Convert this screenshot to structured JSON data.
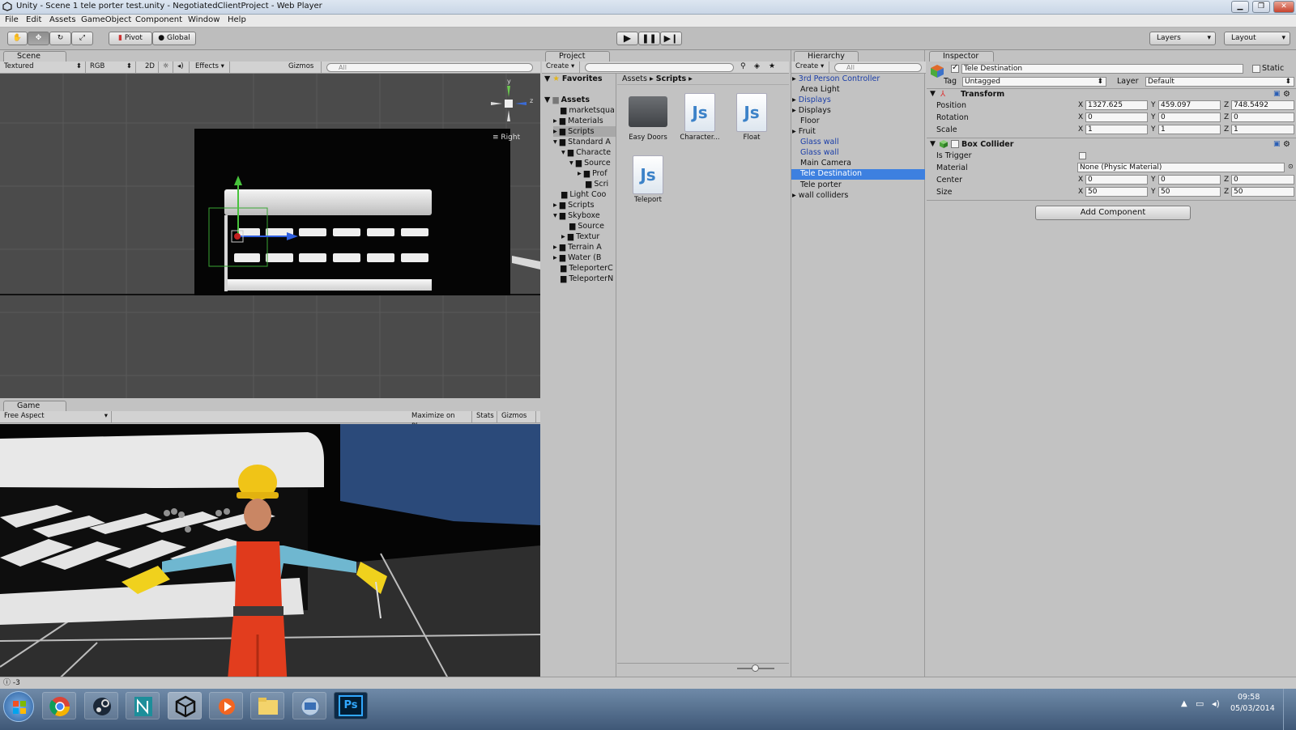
{
  "window": {
    "title": "Unity - Scene 1 tele porter test.unity - NegotiatedClientProject - Web Player",
    "min": "▁",
    "max": "❐",
    "close": "✕"
  },
  "menu": [
    "File",
    "Edit",
    "Assets",
    "GameObject",
    "Component",
    "Window",
    "Help"
  ],
  "toolbar": {
    "pivot": "Pivot",
    "global": "Global",
    "layers": "Layers",
    "layout": "Layout"
  },
  "scene": {
    "tab": "Scene",
    "shading": "Textured",
    "rendermode": "RGB",
    "twod": "2D",
    "effects": "Effects",
    "gizmos": "Gizmos",
    "search_placeholder": "All",
    "view_label": "Right",
    "gizmo_y": "y",
    "gizmo_z": "z"
  },
  "game": {
    "tab": "Game",
    "aspect": "Free Aspect",
    "maximize": "Maximize on Play",
    "stats": "Stats",
    "gizmos": "Gizmos"
  },
  "project": {
    "tab": "Project",
    "create": "Create",
    "favorites": "Favorites",
    "assets": "Assets",
    "breadcrumb": [
      "Assets",
      "Scripts"
    ],
    "tree": [
      "marketsqua",
      "Materials",
      "Scripts",
      "Standard A",
      "Characte",
      "Source",
      "Prof",
      "Scri",
      "Light Coo",
      "Scripts",
      "Skyboxe",
      "Source",
      "Textur",
      "Terrain A",
      "Water (B",
      "TeleporterC",
      "TeleporterN"
    ],
    "files": [
      {
        "name": "Easy Doors",
        "kind": "folder"
      },
      {
        "name": "Character...",
        "kind": "js"
      },
      {
        "name": "Float",
        "kind": "js"
      },
      {
        "name": "Teleport",
        "kind": "js"
      }
    ],
    "js_glyph": "Js"
  },
  "hierarchy": {
    "tab": "Hierarchy",
    "create": "Create",
    "search_placeholder": "All",
    "items": [
      {
        "label": "3rd Person Controller",
        "prefab": true,
        "arrow": true
      },
      {
        "label": "Area Light",
        "prefab": false,
        "arrow": false
      },
      {
        "label": "Displays",
        "prefab": true,
        "arrow": true
      },
      {
        "label": "Displays",
        "prefab": false,
        "arrow": true
      },
      {
        "label": "Floor",
        "prefab": false,
        "arrow": false
      },
      {
        "label": "Fruit",
        "prefab": false,
        "arrow": true
      },
      {
        "label": "Glass wall",
        "prefab": true,
        "arrow": false
      },
      {
        "label": "Glass wall",
        "prefab": true,
        "arrow": false
      },
      {
        "label": "Main Camera",
        "prefab": false,
        "arrow": false
      },
      {
        "label": "Tele Destination",
        "prefab": false,
        "arrow": false,
        "selected": true
      },
      {
        "label": "Tele porter",
        "prefab": false,
        "arrow": false
      },
      {
        "label": "wall colliders",
        "prefab": false,
        "arrow": true
      }
    ]
  },
  "inspector": {
    "tab": "Inspector",
    "object_name": "Tele Destination",
    "static": "Static",
    "tag_label": "Tag",
    "tag": "Untagged",
    "layer_label": "Layer",
    "layer": "Default",
    "transform": {
      "title": "Transform",
      "position": {
        "label": "Position",
        "x": "1327.625",
        "y": "459.097",
        "z": "748.5492"
      },
      "rotation": {
        "label": "Rotation",
        "x": "0",
        "y": "0",
        "z": "0"
      },
      "scale": {
        "label": "Scale",
        "x": "1",
        "y": "1",
        "z": "1"
      }
    },
    "box_collider": {
      "title": "Box Collider",
      "is_trigger": "Is Trigger",
      "material_label": "Material",
      "material": "None (Physic Material)",
      "center": {
        "label": "Center",
        "x": "0",
        "y": "0",
        "z": "0"
      },
      "size": {
        "label": "Size",
        "x": "50",
        "y": "50",
        "z": "50"
      }
    },
    "axis": {
      "x": "X",
      "y": "Y",
      "z": "Z"
    },
    "add_component": "Add Component"
  },
  "status": {
    "text": "-3"
  },
  "taskbar": {
    "time": "09:58",
    "date": "05/03/2014",
    "ps": "Ps"
  }
}
